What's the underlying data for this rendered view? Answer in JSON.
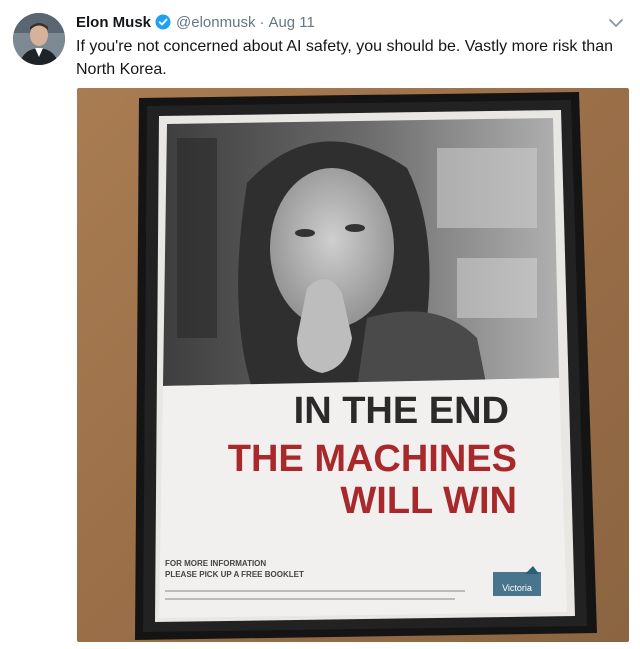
{
  "tweet": {
    "author_name": "Elon Musk",
    "handle": "@elonmusk",
    "separator": "·",
    "timestamp": "Aug 11",
    "text": "If you're not concerned about AI safety, you should be. Vastly more risk than North Korea.",
    "verified": true
  },
  "poster": {
    "line1": "IN THE END",
    "line2": "THE MACHINES",
    "line3": "WILL WIN",
    "fine1": "FOR MORE INFORMATION",
    "fine2": "PLEASE PICK UP A FREE BOOKLET",
    "logo_text": "Victoria",
    "colors": {
      "headline_dark": "#2b2a2a",
      "headline_red": "#a8292c"
    }
  },
  "colors": {
    "verified": "#1da1f2",
    "secondary_text": "#657786"
  }
}
